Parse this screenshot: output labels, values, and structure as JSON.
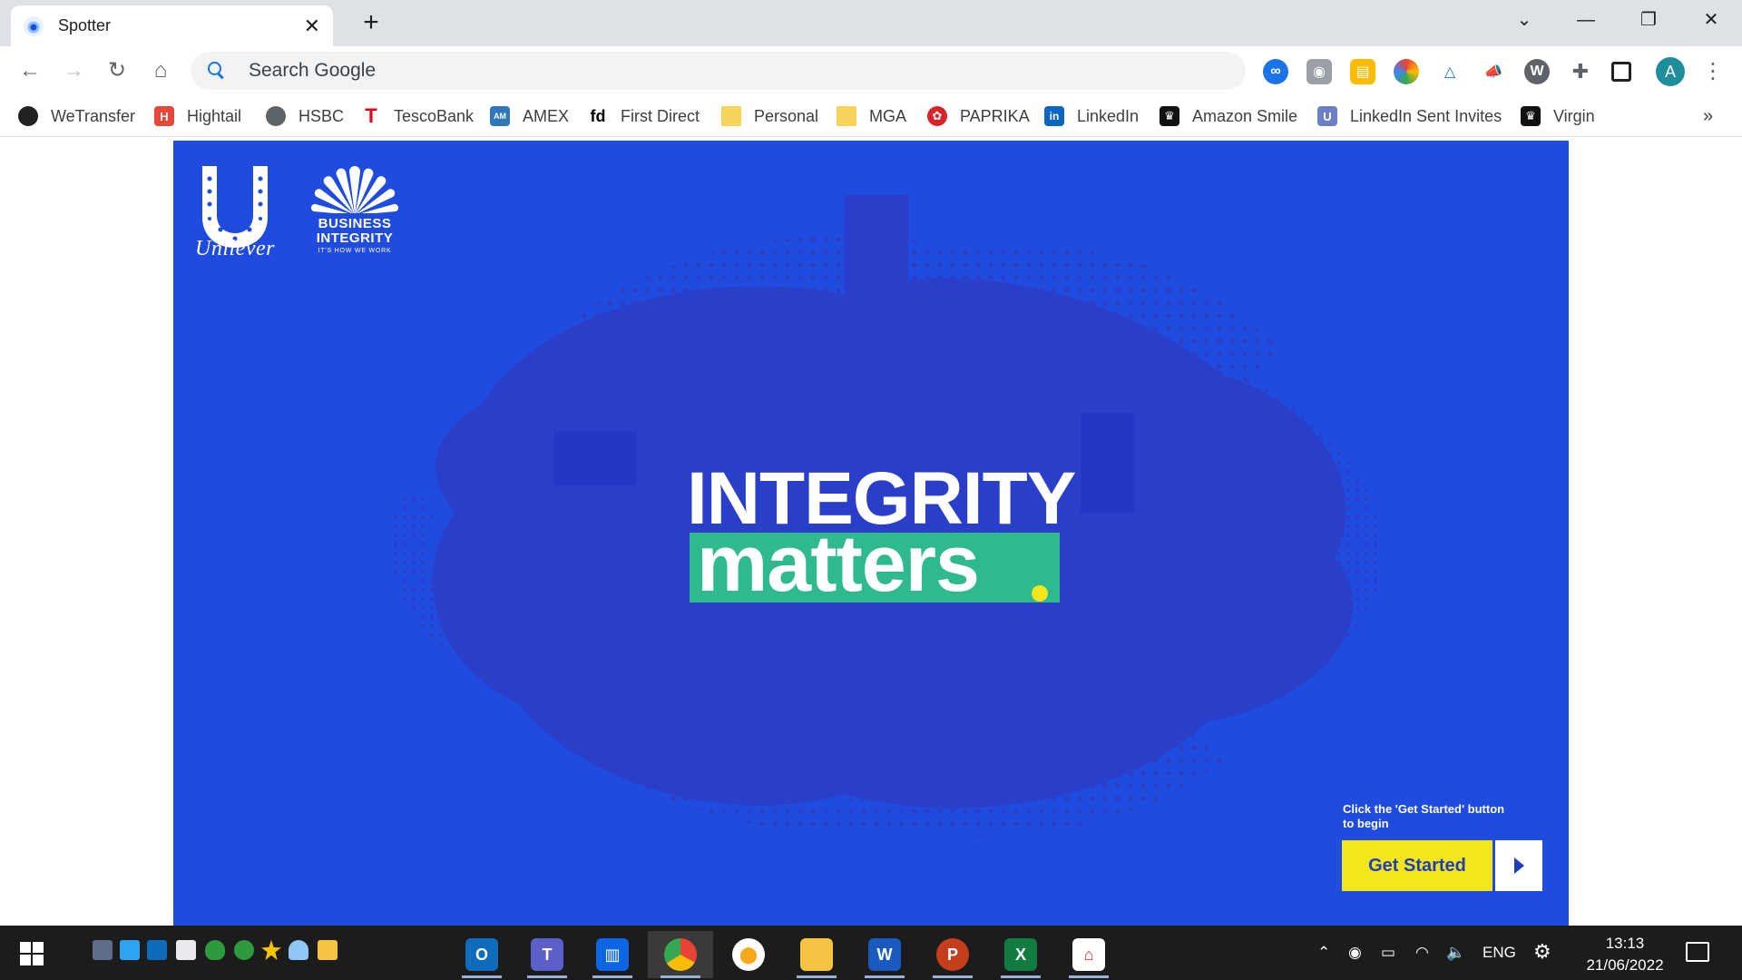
{
  "browser": {
    "tab_title": "Spotter",
    "omnibox_placeholder": "Search Google",
    "profile_initial": "A",
    "bookmarks": [
      {
        "label": "WeTransfer",
        "color": "#222222"
      },
      {
        "label": "Hightail",
        "color": "#e8473b"
      },
      {
        "label": "HSBC",
        "color": "#5f6368"
      },
      {
        "label": "TescoBank",
        "color": "#e2001a"
      },
      {
        "label": "AMEX",
        "color": "#2e77bb"
      },
      {
        "label": "First Direct",
        "color": "#000000"
      },
      {
        "label": "Personal",
        "color": "#f6d35b"
      },
      {
        "label": "MGA",
        "color": "#f6d35b"
      },
      {
        "label": "PAPRIKA",
        "color": "#d8232a"
      },
      {
        "label": "LinkedIn",
        "color": "#0a66c2"
      },
      {
        "label": "Amazon Smile",
        "color": "#111111"
      },
      {
        "label": "LinkedIn Sent Invites",
        "color": "#6d7fc4"
      },
      {
        "label": "Virgin",
        "color": "#111111"
      }
    ],
    "bookmarks_more": "»"
  },
  "page": {
    "brand": "Unilever",
    "program_title_line1": "BUSINESS",
    "program_title_line2": "INTEGRITY",
    "program_tagline": "IT'S HOW WE WORK",
    "headline_top": "INTEGRITY",
    "headline_bottom": "matters",
    "hint": "Click the 'Get Started' button to begin",
    "cta_label": "Get Started",
    "colors": {
      "background": "#1f4bdf",
      "accent_green": "#2fb98e",
      "accent_yellow": "#f5e61b"
    }
  },
  "taskbar": {
    "apps": [
      "outlook",
      "teams",
      "trello",
      "chrome",
      "keeper",
      "file-explorer",
      "word",
      "powerpoint",
      "excel",
      "acrobat"
    ],
    "language": "ENG",
    "time": "13:13",
    "date": "21/06/2022"
  }
}
